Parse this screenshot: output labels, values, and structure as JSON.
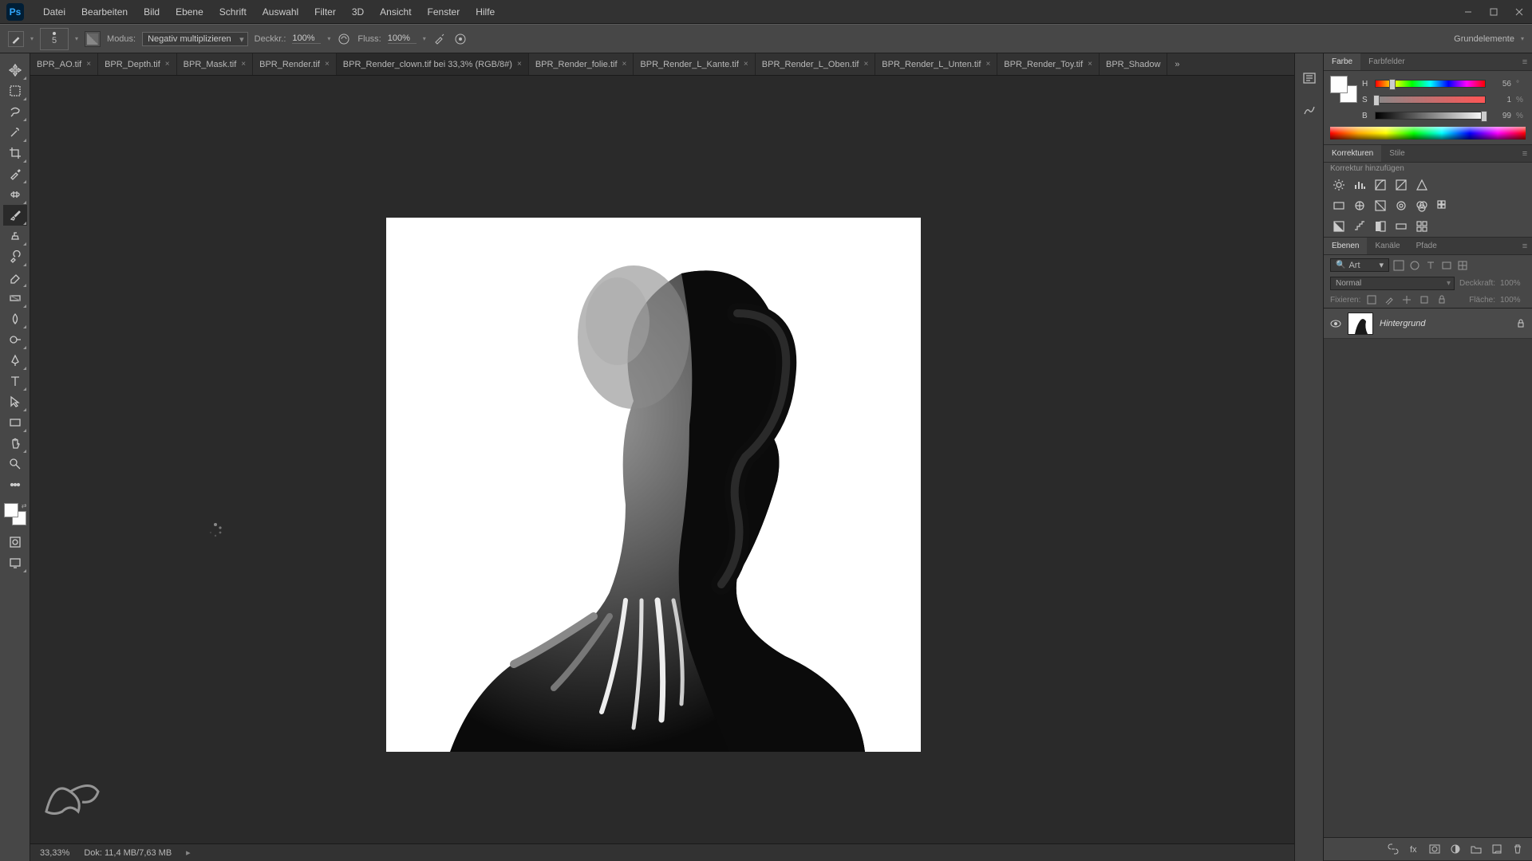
{
  "menu": {
    "file": "Datei",
    "edit": "Bearbeiten",
    "image": "Bild",
    "layer": "Ebene",
    "type": "Schrift",
    "select": "Auswahl",
    "filter": "Filter",
    "3d": "3D",
    "view": "Ansicht",
    "window": "Fenster",
    "help": "Hilfe"
  },
  "options": {
    "brushSize": "5",
    "modeLabel": "Modus:",
    "mode": "Negativ multiplizieren",
    "opacityLabel": "Deckkr.:",
    "opacity": "100%",
    "flowLabel": "Fluss:",
    "flow": "100%",
    "workspace": "Grundelemente"
  },
  "tabs": [
    {
      "label": "BPR_AO.tif",
      "active": false
    },
    {
      "label": "BPR_Depth.tif",
      "active": false
    },
    {
      "label": "BPR_Mask.tif",
      "active": false
    },
    {
      "label": "BPR_Render.tif",
      "active": false
    },
    {
      "label": "BPR_Render_clown.tif bei 33,3% (RGB/8#)",
      "active": true
    },
    {
      "label": "BPR_Render_folie.tif",
      "active": false
    },
    {
      "label": "BPR_Render_L_Kante.tif",
      "active": false
    },
    {
      "label": "BPR_Render_L_Oben.tif",
      "active": false
    },
    {
      "label": "BPR_Render_L_Unten.tif",
      "active": false
    },
    {
      "label": "BPR_Render_Toy.tif",
      "active": false
    },
    {
      "label": "BPR_Shadow",
      "active": false
    }
  ],
  "status": {
    "zoom": "33,33%",
    "docLabel": "Dok:",
    "docSize": "11,4 MB/7,63 MB"
  },
  "colorPanel": {
    "tab1": "Farbe",
    "tab2": "Farbfelder",
    "h": {
      "label": "H",
      "value": "56",
      "pos": 15
    },
    "s": {
      "label": "S",
      "value": "1",
      "pos": 1
    },
    "b": {
      "label": "B",
      "value": "99",
      "pos": 99
    },
    "pct": "%"
  },
  "adjustPanel": {
    "tab1": "Korrekturen",
    "tab2": "Stile",
    "addLabel": "Korrektur hinzufügen"
  },
  "layersPanel": {
    "tab1": "Ebenen",
    "tab2": "Kanäle",
    "tab3": "Pfade",
    "filter": "Art",
    "blend": "Normal",
    "opacityLabel": "Deckkraft:",
    "opacity": "100%",
    "lockLabel": "Fixieren:",
    "fillLabel": "Fläche:",
    "fill": "100%",
    "layerName": "Hintergrund"
  }
}
